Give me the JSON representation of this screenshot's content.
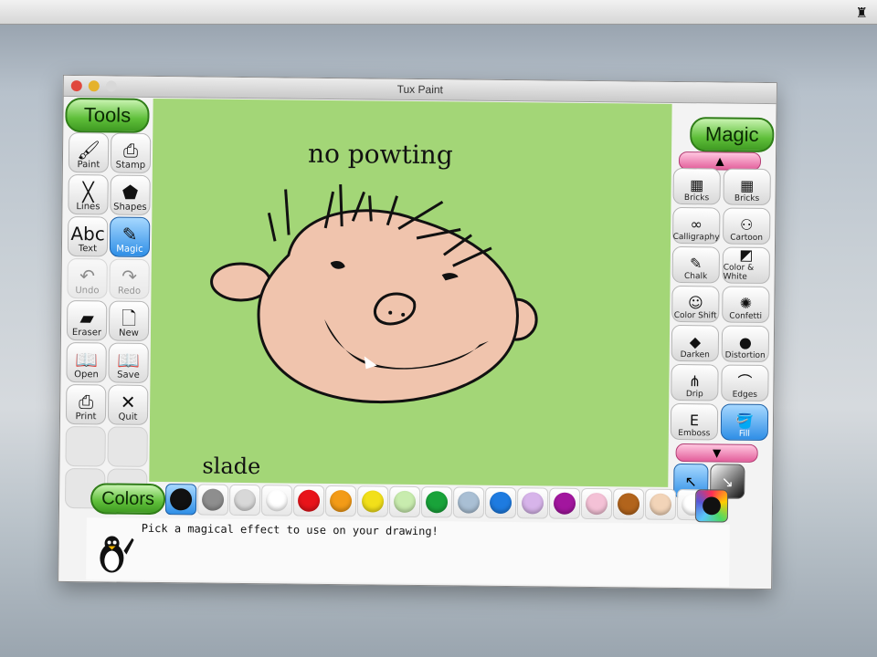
{
  "window": {
    "title": "Tux Paint"
  },
  "tools": {
    "header": "Tools",
    "items": [
      {
        "label": "Paint",
        "icon": "paintbrush-icon",
        "glyph": "🖌",
        "state": "normal"
      },
      {
        "label": "Stamp",
        "icon": "stamp-icon",
        "glyph": "⎙",
        "state": "normal"
      },
      {
        "label": "Lines",
        "icon": "lines-icon",
        "glyph": "╳",
        "state": "normal"
      },
      {
        "label": "Shapes",
        "icon": "pentagon-icon",
        "glyph": "⬟",
        "state": "normal"
      },
      {
        "label": "Text",
        "icon": "text-icon",
        "glyph": "Abc",
        "state": "normal"
      },
      {
        "label": "Magic",
        "icon": "magic-wand-icon",
        "glyph": "✎",
        "state": "active"
      },
      {
        "label": "Undo",
        "icon": "undo-icon",
        "glyph": "↶",
        "state": "disabled"
      },
      {
        "label": "Redo",
        "icon": "redo-icon",
        "glyph": "↷",
        "state": "disabled"
      },
      {
        "label": "Eraser",
        "icon": "eraser-icon",
        "glyph": "▰",
        "state": "normal"
      },
      {
        "label": "New",
        "icon": "new-page-icon",
        "glyph": "🗋",
        "state": "normal"
      },
      {
        "label": "Open",
        "icon": "open-book-icon",
        "glyph": "📖",
        "state": "normal"
      },
      {
        "label": "Save",
        "icon": "save-book-icon",
        "glyph": "📖",
        "state": "normal"
      },
      {
        "label": "Print",
        "icon": "printer-icon",
        "glyph": "⎙",
        "state": "normal"
      },
      {
        "label": "Quit",
        "icon": "quit-icon",
        "glyph": "✕",
        "state": "normal"
      }
    ]
  },
  "canvas": {
    "text_top": "no powting",
    "text_bottom": "slade",
    "background": "#a3d677"
  },
  "magic": {
    "header": "Magic",
    "items": [
      {
        "label": "Bricks",
        "icon": "bricks-icon",
        "glyph": "▦",
        "state": "normal"
      },
      {
        "label": "Bricks",
        "icon": "bricks-large-icon",
        "glyph": "▦",
        "state": "normal"
      },
      {
        "label": "Calligraphy",
        "icon": "calligraphy-icon",
        "glyph": "∞",
        "state": "normal"
      },
      {
        "label": "Cartoon",
        "icon": "cartoon-icon",
        "glyph": "⚇",
        "state": "normal"
      },
      {
        "label": "Chalk",
        "icon": "chalk-icon",
        "glyph": "✎",
        "state": "normal"
      },
      {
        "label": "Color & White",
        "icon": "color-white-icon",
        "glyph": "◩",
        "state": "normal"
      },
      {
        "label": "Color Shift",
        "icon": "color-shift-icon",
        "glyph": "☺",
        "state": "normal"
      },
      {
        "label": "Confetti",
        "icon": "confetti-icon",
        "glyph": "✺",
        "state": "normal"
      },
      {
        "label": "Darken",
        "icon": "darken-icon",
        "glyph": "◆",
        "state": "normal"
      },
      {
        "label": "Distortion",
        "icon": "distortion-icon",
        "glyph": "●",
        "state": "normal"
      },
      {
        "label": "Drip",
        "icon": "drip-icon",
        "glyph": "⋔",
        "state": "normal"
      },
      {
        "label": "Edges",
        "icon": "edges-icon",
        "glyph": "⌒",
        "state": "normal"
      },
      {
        "label": "Emboss",
        "icon": "emboss-icon",
        "glyph": "E",
        "state": "normal"
      },
      {
        "label": "Fill",
        "icon": "fill-bucket-icon",
        "glyph": "🪣",
        "state": "active"
      }
    ],
    "scroll_up": "▲",
    "scroll_down": "▼",
    "mode_paint": "↖",
    "mode_fullscreen": "↘"
  },
  "colors": {
    "header": "Colors",
    "swatches": [
      "#111111",
      "#8e8e8e",
      "#d8d8d8",
      "#ffffff",
      "#e8141a",
      "#f39b17",
      "#f2e01a",
      "#c8ecae",
      "#19a33a",
      "#a9bfd4",
      "#1e7be0",
      "#d7b4ea",
      "#a2169e",
      "#f4c1d6",
      "#b2641c",
      "#f2d4b8",
      "#ffffff"
    ],
    "selected_index": 0
  },
  "status": {
    "message": "Pick a magical effect to use on your drawing!"
  }
}
